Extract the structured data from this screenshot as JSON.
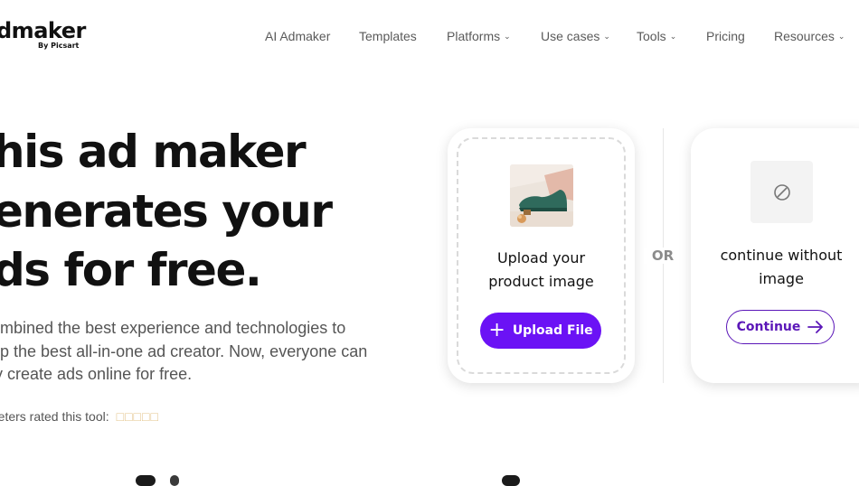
{
  "brand": {
    "name": "dmaker",
    "sub": "By Picsart"
  },
  "nav": {
    "items": [
      {
        "label": "AI Admaker",
        "dropdown": false
      },
      {
        "label": "Templates",
        "dropdown": false
      },
      {
        "label": "Platforms",
        "dropdown": true
      },
      {
        "label": "Use cases",
        "dropdown": true
      },
      {
        "label": "Tools",
        "dropdown": true
      },
      {
        "label": "Pricing",
        "dropdown": false
      },
      {
        "label": "Resources",
        "dropdown": true
      }
    ]
  },
  "hero": {
    "lines": [
      "his ad maker",
      "enerates your",
      "ds for free."
    ],
    "description": [
      "ombined the best experience and technologies to",
      "op the best all-in-one ad creator. Now, everyone can",
      "ly create ads online for free."
    ],
    "rating_label": "rketers rated this tool:",
    "stars": "□□□□□"
  },
  "upload_card": {
    "title_line1": "Upload your",
    "title_line2": "product image",
    "button_label": "Upload File",
    "button_color": "#6b12f5"
  },
  "or_label": "OR",
  "noimage_card": {
    "title_line1": "continue without",
    "title_line2": "image",
    "button_label": "Continue",
    "accent_color": "#5b17b8"
  },
  "icons": [
    "plus-icon",
    "no-image-icon",
    "arrow-right-icon",
    "chevron-down-icon",
    "shoe-product-image"
  ]
}
